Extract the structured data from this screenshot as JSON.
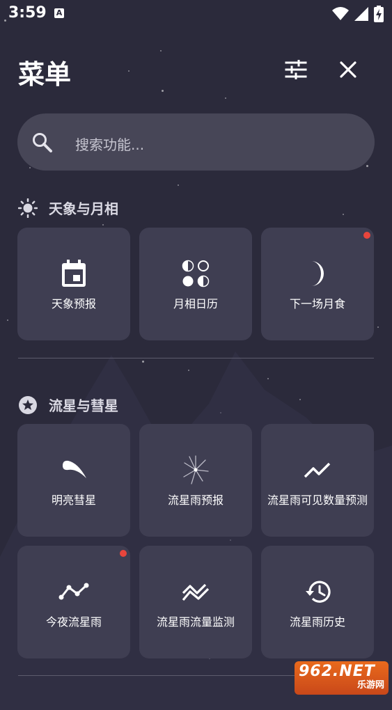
{
  "status_bar": {
    "time": "3:59",
    "indicator": "A",
    "icons": [
      "wifi-icon",
      "signal-icon",
      "battery-charging-icon"
    ]
  },
  "header": {
    "title": "菜单",
    "icons": [
      "filter-settings-icon",
      "close-icon"
    ]
  },
  "search": {
    "placeholder": "搜索功能..."
  },
  "sections": [
    {
      "title": "天象与月相",
      "icon": "sun-icon",
      "cards": [
        {
          "label": "天象预报",
          "icon": "calendar-icon",
          "badge": false
        },
        {
          "label": "月相日历",
          "icon": "moon-phases-icon",
          "badge": false
        },
        {
          "label": "下一场月食",
          "icon": "crescent-moon-icon",
          "badge": true
        }
      ]
    },
    {
      "title": "流星与彗星",
      "icon": "star-circle-icon",
      "cards": [
        {
          "label": "明亮彗星",
          "icon": "comet-icon",
          "badge": false
        },
        {
          "label": "流星雨预报",
          "icon": "meteor-burst-icon",
          "badge": false
        },
        {
          "label": "流星雨可见数量预测",
          "icon": "trend-up-icon",
          "badge": false
        },
        {
          "label": "今夜流星雨",
          "icon": "timeline-icon",
          "badge": true
        },
        {
          "label": "流星雨流量监测",
          "icon": "multiline-chart-icon",
          "badge": false
        },
        {
          "label": "流星雨历史",
          "icon": "history-icon",
          "badge": false
        }
      ]
    }
  ],
  "watermark": {
    "top": "962.NET",
    "bottom": "乐游网"
  },
  "colors": {
    "background": "#2b2a3b",
    "card": "#3f3e52",
    "search": "#474657",
    "badge": "#e8453c"
  }
}
